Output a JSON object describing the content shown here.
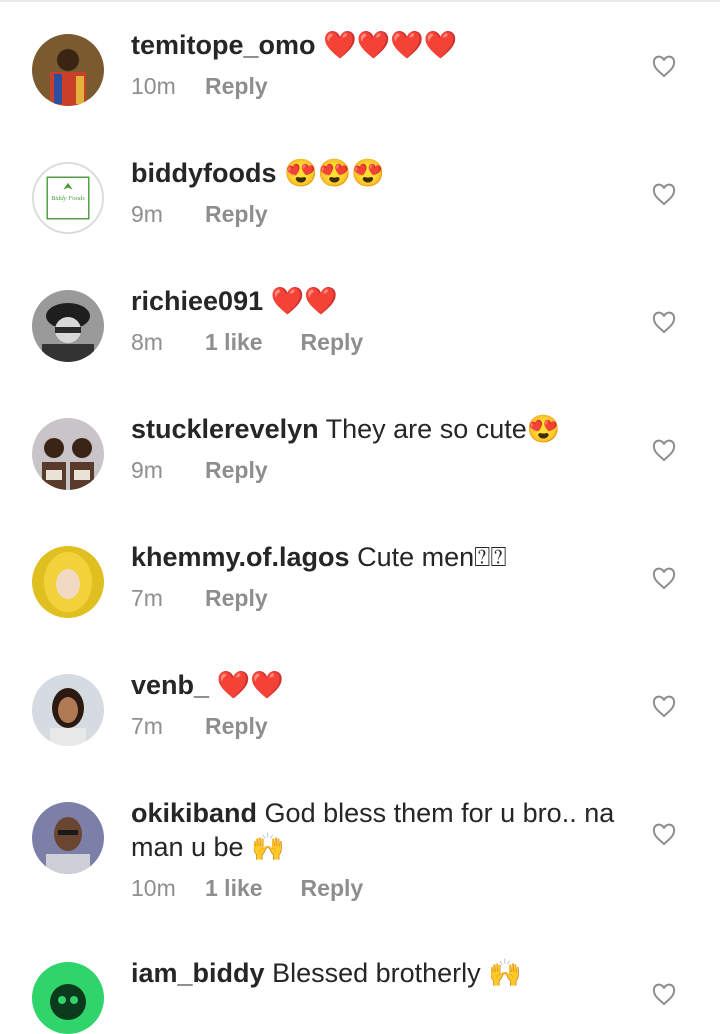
{
  "comments": [
    {
      "username": "temitope_omo",
      "text": "❤️❤️❤️❤️",
      "time": "10m",
      "likes": "",
      "reply": "Reply"
    },
    {
      "username": "biddyfoods",
      "text": "😍😍😍",
      "time": "9m",
      "likes": "",
      "reply": "Reply",
      "avatar_text": "Biddy Foods"
    },
    {
      "username": "richiee091",
      "text": "❤️❤️",
      "time": "8m",
      "likes": "1 like",
      "reply": "Reply"
    },
    {
      "username": "stucklerevelyn",
      "text": "They are so cute😍",
      "time": "9m",
      "likes": "",
      "reply": "Reply"
    },
    {
      "username": "khemmy.of.lagos",
      "text": "Cute men⍰⍰",
      "time": "7m",
      "likes": "",
      "reply": "Reply"
    },
    {
      "username": "venb_",
      "text": "❤️❤️",
      "time": "7m",
      "likes": "",
      "reply": "Reply"
    },
    {
      "username": "okikiband",
      "text": "God bless them for u bro.. na man u be 🙌",
      "time": "10m",
      "likes": "1 like",
      "reply": "Reply"
    },
    {
      "username": "iam_biddy",
      "text": "Blessed brotherly 🙌",
      "time": "",
      "likes": "",
      "reply": ""
    }
  ],
  "icons": {
    "like": "heart-outline-icon"
  },
  "colors": {
    "text": "#262626",
    "secondary": "#8e8e8e",
    "icon": "#8e8e8e"
  }
}
